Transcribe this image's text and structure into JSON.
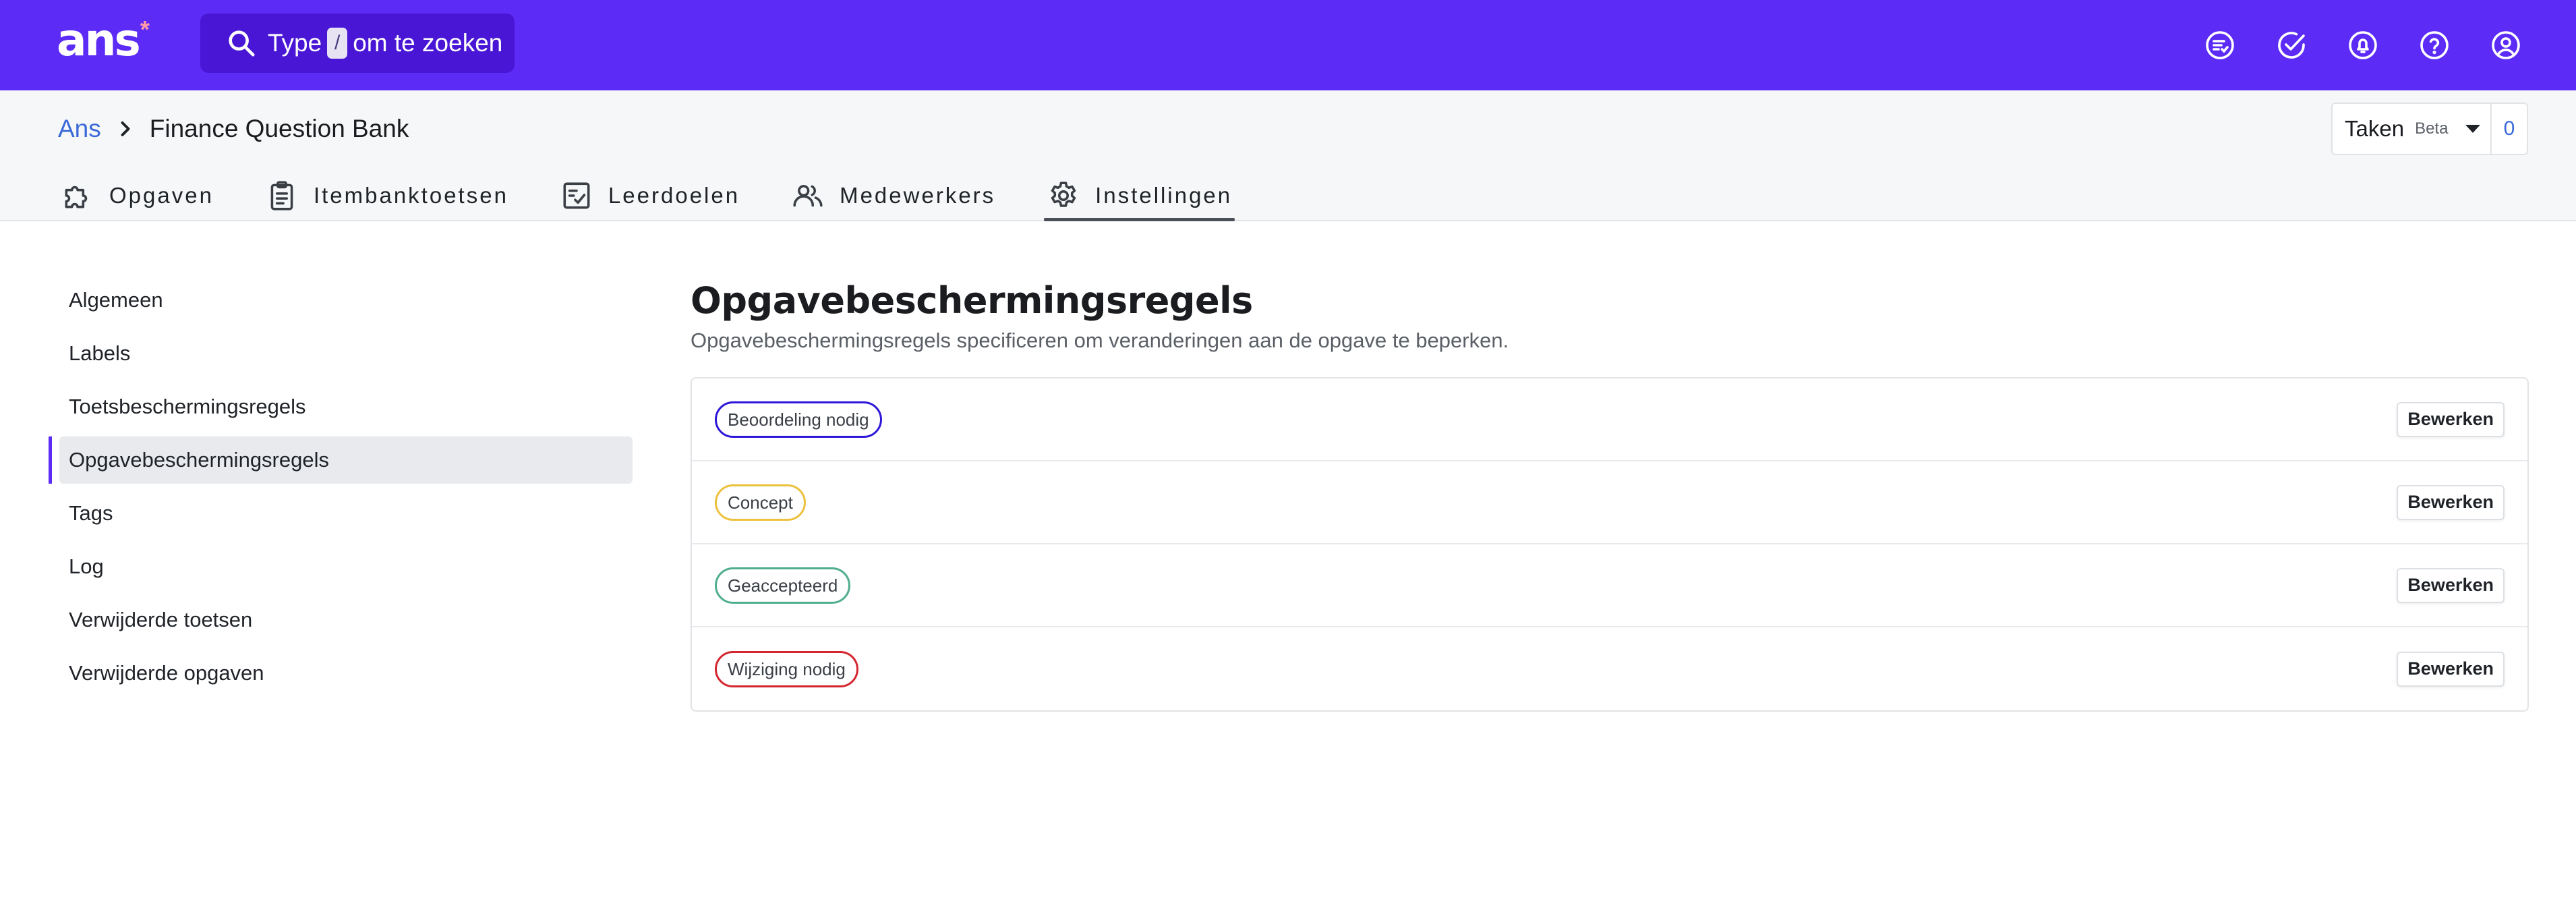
{
  "header": {
    "logo_text": "ans",
    "logo_mark": "*",
    "search": {
      "prefix": "Type",
      "shortcut": "/",
      "suffix": "om te zoeken"
    },
    "icons": [
      "tasks-list-icon",
      "check-circle-icon",
      "bell-icon",
      "help-icon",
      "user-icon"
    ]
  },
  "breadcrumb": {
    "root": "Ans",
    "current": "Finance Question Bank"
  },
  "taken": {
    "label": "Taken",
    "beta": "Beta",
    "count": "0"
  },
  "tabs": [
    {
      "label": "Opgaven",
      "icon": "puzzle-icon",
      "active": false
    },
    {
      "label": "Itembanktoetsen",
      "icon": "clipboard-icon",
      "active": false
    },
    {
      "label": "Leerdoelen",
      "icon": "checklist-icon",
      "active": false
    },
    {
      "label": "Medewerkers",
      "icon": "users-icon",
      "active": false
    },
    {
      "label": "Instellingen",
      "icon": "gear-icon",
      "active": true
    }
  ],
  "sidebar": {
    "items": [
      {
        "label": "Algemeen",
        "active": false
      },
      {
        "label": "Labels",
        "active": false
      },
      {
        "label": "Toetsbeschermingsregels",
        "active": false
      },
      {
        "label": "Opgavebeschermingsregels",
        "active": true
      },
      {
        "label": "Tags",
        "active": false
      },
      {
        "label": "Log",
        "active": false
      },
      {
        "label": "Verwijderde toetsen",
        "active": false
      },
      {
        "label": "Verwijderde opgaven",
        "active": false
      }
    ]
  },
  "main": {
    "title": "Opgavebeschermingsregels",
    "description": "Opgavebeschermingsregels specificeren om veranderingen aan de opgave te beperken.",
    "rules": [
      {
        "label": "Beoordeling nodig",
        "color": "#2d17d8",
        "action": "Bewerken"
      },
      {
        "label": "Concept",
        "color": "#ecc13c",
        "action": "Bewerken"
      },
      {
        "label": "Geaccepteerd",
        "color": "#4fae8c",
        "action": "Bewerken"
      },
      {
        "label": "Wijziging nodig",
        "color": "#d4262f",
        "action": "Bewerken"
      }
    ]
  },
  "colors": {
    "brand": "#5c2cf6",
    "search_bg": "#4a16d6",
    "link": "#3a6ad8"
  }
}
